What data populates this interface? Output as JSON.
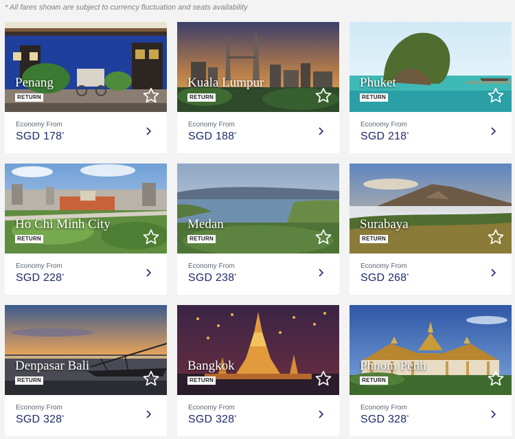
{
  "disclaimer": "* All fares shown are subject to currency fluctuation and seats availability",
  "accent_color": "#1e2a6a",
  "destinations": [
    {
      "city": "Penang",
      "badge": "RETURN",
      "fare_label": "Economy From",
      "currency": "SGD",
      "amount": "178",
      "note_mark": "*",
      "icons": {
        "star": "star-outline-icon",
        "chevron": "chevron-right-icon"
      }
    },
    {
      "city": "Kuala Lumpur",
      "badge": "RETURN",
      "fare_label": "Economy From",
      "currency": "SGD",
      "amount": "188",
      "note_mark": "*",
      "icons": {
        "star": "star-outline-icon",
        "chevron": "chevron-right-icon"
      }
    },
    {
      "city": "Phuket",
      "badge": "RETURN",
      "fare_label": "Economy From",
      "currency": "SGD",
      "amount": "218",
      "note_mark": "*",
      "icons": {
        "star": "star-outline-icon",
        "chevron": "chevron-right-icon"
      }
    },
    {
      "city": "Ho Chi Minh City",
      "badge": "RETURN",
      "fare_label": "Economy From",
      "currency": "SGD",
      "amount": "228",
      "note_mark": "*",
      "icons": {
        "star": "star-outline-icon",
        "chevron": "chevron-right-icon"
      }
    },
    {
      "city": "Medan",
      "badge": "RETURN",
      "fare_label": "Economy From",
      "currency": "SGD",
      "amount": "238",
      "note_mark": "*",
      "icons": {
        "star": "star-outline-icon",
        "chevron": "chevron-right-icon"
      }
    },
    {
      "city": "Surabaya",
      "badge": "RETURN",
      "fare_label": "Economy From",
      "currency": "SGD",
      "amount": "268",
      "note_mark": "*",
      "icons": {
        "star": "star-outline-icon",
        "chevron": "chevron-right-icon"
      }
    },
    {
      "city": "Denpasar Bali",
      "badge": "RETURN",
      "fare_label": "Economy From",
      "currency": "SGD",
      "amount": "328",
      "note_mark": "*",
      "icons": {
        "star": "star-outline-icon",
        "chevron": "chevron-right-icon"
      }
    },
    {
      "city": "Bangkok",
      "badge": "RETURN",
      "fare_label": "Economy From",
      "currency": "SGD",
      "amount": "328",
      "note_mark": "*",
      "icons": {
        "star": "star-outline-icon",
        "chevron": "chevron-right-icon"
      }
    },
    {
      "city": "Phnom Penh",
      "badge": "RETURN",
      "fare_label": "Economy From",
      "currency": "SGD",
      "amount": "328",
      "note_mark": "*",
      "icons": {
        "star": "star-outline-icon",
        "chevron": "chevron-right-icon"
      }
    }
  ]
}
